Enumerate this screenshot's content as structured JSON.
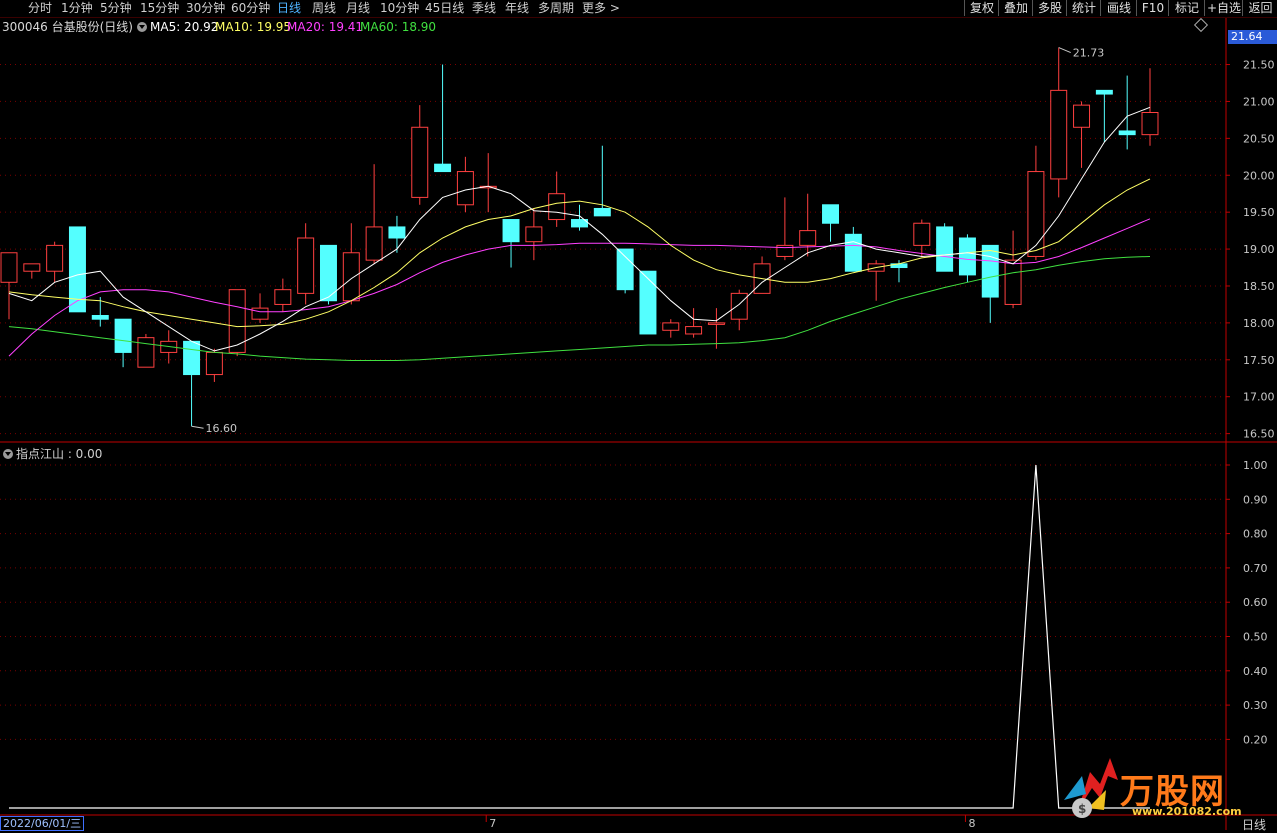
{
  "toolbar": {
    "periods": [
      "分时",
      "1分钟",
      "5分钟",
      "15分钟",
      "30分钟",
      "60分钟",
      "日线",
      "周线",
      "月线",
      "10分钟",
      "45日线",
      "季线",
      "年线",
      "多周期",
      "更多 >"
    ],
    "active_period": "日线",
    "buttons": [
      "复权",
      "叠加",
      "多股",
      "统计",
      "画线",
      "F10",
      "标记",
      "+自选",
      "返回"
    ]
  },
  "stock": {
    "code_name": "300046 台基股份(日线)",
    "ma5_label": "MA5: 20.92",
    "ma10_label": "MA10: 19.95",
    "ma20_label": "MA20: 19.41",
    "ma60_label": "MA60: 18.90",
    "current_price": "21.64"
  },
  "indicator": {
    "label": "指点江山 : 0.00"
  },
  "bottom": {
    "date": "2022/06/01/三",
    "period": "日线",
    "month_labels": [
      "7",
      "8"
    ]
  },
  "watermark": {
    "text": "万股网",
    "url": "www.201082.com"
  },
  "colors": {
    "background": "#000000",
    "up": "#ff4040",
    "down": "#54ffff",
    "ma5": "#ffffff",
    "ma10": "#ffff66",
    "ma20": "#ff40ff",
    "ma60": "#40e040",
    "grid": "#7a0000",
    "axis": "#c00000"
  },
  "chart_data": [
    {
      "type": "candlestick",
      "title": "300046 台基股份(日线)",
      "y_ticks": [
        "21.50",
        "21.00",
        "20.50",
        "20.00",
        "19.50",
        "19.00",
        "18.50",
        "18.00",
        "17.50",
        "17.00",
        "16.50"
      ],
      "ylim": [
        16.4,
        21.9
      ],
      "max_label": "21.73",
      "min_label": "16.60",
      "candles": [
        [
          18.55,
          18.95,
          18.05,
          18.95
        ],
        [
          18.7,
          18.8,
          18.6,
          18.8
        ],
        [
          18.7,
          19.1,
          18.55,
          19.05
        ],
        [
          19.3,
          19.3,
          18.15,
          18.15
        ],
        [
          18.1,
          18.35,
          17.95,
          18.05
        ],
        [
          18.05,
          18.05,
          17.4,
          17.6
        ],
        [
          17.4,
          17.85,
          17.4,
          17.8
        ],
        [
          17.6,
          17.9,
          17.45,
          17.75
        ],
        [
          17.75,
          17.75,
          16.6,
          17.3
        ],
        [
          17.3,
          17.65,
          17.2,
          17.6
        ],
        [
          17.6,
          18.1,
          17.55,
          18.45
        ],
        [
          18.05,
          18.4,
          18.0,
          18.2
        ],
        [
          18.25,
          18.6,
          18.15,
          18.45
        ],
        [
          18.4,
          19.35,
          18.25,
          19.15
        ],
        [
          19.05,
          19.05,
          18.25,
          18.3
        ],
        [
          18.3,
          19.35,
          18.25,
          18.95
        ],
        [
          18.85,
          20.15,
          18.8,
          19.3
        ],
        [
          19.3,
          19.45,
          18.95,
          19.15
        ],
        [
          19.7,
          20.95,
          19.6,
          20.65
        ],
        [
          20.15,
          21.5,
          20.05,
          20.05
        ],
        [
          19.6,
          20.25,
          19.5,
          20.05
        ],
        [
          19.85,
          20.3,
          19.5,
          19.85
        ],
        [
          19.4,
          19.4,
          18.75,
          19.1
        ],
        [
          19.1,
          19.55,
          18.85,
          19.3
        ],
        [
          19.4,
          20.05,
          19.3,
          19.75
        ],
        [
          19.4,
          19.6,
          19.25,
          19.3
        ],
        [
          19.55,
          20.4,
          19.5,
          19.45
        ],
        [
          19.0,
          19.0,
          18.4,
          18.45
        ],
        [
          18.7,
          18.7,
          17.85,
          17.85
        ],
        [
          17.9,
          18.05,
          17.8,
          18.0
        ],
        [
          17.85,
          18.2,
          17.8,
          17.95
        ],
        [
          18.0,
          18.2,
          17.65,
          18.0
        ],
        [
          18.05,
          18.45,
          17.9,
          18.4
        ],
        [
          18.4,
          18.9,
          18.4,
          18.8
        ],
        [
          18.9,
          19.7,
          18.85,
          19.05
        ],
        [
          19.05,
          19.75,
          18.9,
          19.25
        ],
        [
          19.6,
          19.6,
          19.1,
          19.35
        ],
        [
          19.2,
          19.3,
          18.7,
          18.7
        ],
        [
          18.7,
          18.85,
          18.3,
          18.8
        ],
        [
          18.8,
          18.85,
          18.55,
          18.75
        ],
        [
          19.05,
          19.4,
          18.9,
          19.35
        ],
        [
          19.3,
          19.35,
          18.7,
          18.7
        ],
        [
          19.15,
          19.2,
          18.55,
          18.65
        ],
        [
          19.05,
          19.05,
          18.0,
          18.35
        ],
        [
          18.25,
          19.25,
          18.2,
          18.85
        ],
        [
          18.9,
          20.4,
          18.85,
          20.05
        ],
        [
          19.95,
          21.73,
          19.7,
          21.15
        ],
        [
          20.65,
          21.0,
          20.1,
          20.95
        ],
        [
          21.15,
          21.15,
          20.45,
          21.1
        ],
        [
          20.6,
          21.35,
          20.35,
          20.55
        ],
        [
          20.55,
          21.45,
          20.4,
          20.85
        ]
      ],
      "ma5": [
        18.4,
        18.3,
        18.55,
        18.65,
        18.7,
        18.35,
        18.15,
        17.95,
        17.75,
        17.62,
        17.7,
        17.85,
        18.02,
        18.22,
        18.35,
        18.6,
        18.8,
        19.0,
        19.4,
        19.7,
        19.8,
        19.85,
        19.75,
        19.52,
        19.5,
        19.45,
        19.2,
        18.9,
        18.6,
        18.3,
        18.05,
        18.03,
        18.25,
        18.55,
        18.75,
        18.95,
        19.05,
        19.1,
        19.0,
        18.95,
        18.9,
        18.92,
        18.95,
        18.9,
        18.8,
        19.05,
        19.45,
        19.95,
        20.45,
        20.8,
        20.92
      ],
      "ma10": [
        18.42,
        18.38,
        18.35,
        18.32,
        18.3,
        18.22,
        18.15,
        18.1,
        18.05,
        18.0,
        17.95,
        17.96,
        17.98,
        18.05,
        18.15,
        18.3,
        18.48,
        18.68,
        18.95,
        19.15,
        19.3,
        19.4,
        19.45,
        19.55,
        19.62,
        19.65,
        19.6,
        19.5,
        19.3,
        19.05,
        18.85,
        18.72,
        18.65,
        18.6,
        18.55,
        18.55,
        18.6,
        18.68,
        18.75,
        18.8,
        18.88,
        18.92,
        18.95,
        18.98,
        18.92,
        18.98,
        19.1,
        19.35,
        19.6,
        19.8,
        19.95
      ],
      "ma20": [
        17.55,
        17.85,
        18.1,
        18.3,
        18.42,
        18.45,
        18.45,
        18.42,
        18.35,
        18.28,
        18.22,
        18.15,
        18.15,
        18.18,
        18.22,
        18.3,
        18.4,
        18.52,
        18.68,
        18.82,
        18.92,
        19.0,
        19.05,
        19.05,
        19.06,
        19.08,
        19.08,
        19.08,
        19.07,
        19.06,
        19.05,
        19.05,
        19.04,
        19.03,
        19.02,
        19.03,
        19.04,
        19.05,
        19.03,
        18.98,
        18.94,
        18.9,
        18.86,
        18.84,
        18.8,
        18.82,
        18.9,
        19.02,
        19.15,
        19.28,
        19.41
      ],
      "ma60": [
        17.95,
        17.92,
        17.88,
        17.84,
        17.8,
        17.76,
        17.72,
        17.68,
        17.64,
        17.6,
        17.58,
        17.55,
        17.53,
        17.51,
        17.5,
        17.49,
        17.49,
        17.49,
        17.5,
        17.52,
        17.54,
        17.56,
        17.58,
        17.6,
        17.62,
        17.64,
        17.66,
        17.68,
        17.7,
        17.7,
        17.71,
        17.72,
        17.73,
        17.76,
        17.8,
        17.9,
        18.02,
        18.12,
        18.22,
        18.32,
        18.4,
        18.48,
        18.55,
        18.62,
        18.68,
        18.72,
        18.78,
        18.83,
        18.87,
        18.89,
        18.9
      ]
    },
    {
      "type": "line",
      "title": "指点江山 : 0.00",
      "y_ticks": [
        "1.00",
        "0.90",
        "0.80",
        "0.70",
        "0.60",
        "0.50",
        "0.40",
        "0.30",
        "0.20"
      ],
      "ylim": [
        0.0,
        1.0
      ],
      "series": [
        {
          "name": "指点江山",
          "values": [
            0,
            0,
            0,
            0,
            0,
            0,
            0,
            0,
            0,
            0,
            0,
            0,
            0,
            0,
            0,
            0,
            0,
            0,
            0,
            0,
            0,
            0,
            0,
            0,
            0,
            0,
            0,
            0,
            0,
            0,
            0,
            0,
            0,
            0,
            0,
            0,
            0,
            0,
            0,
            0,
            0,
            0,
            0,
            0,
            0,
            1,
            0,
            0,
            0,
            0,
            0
          ]
        }
      ]
    }
  ]
}
